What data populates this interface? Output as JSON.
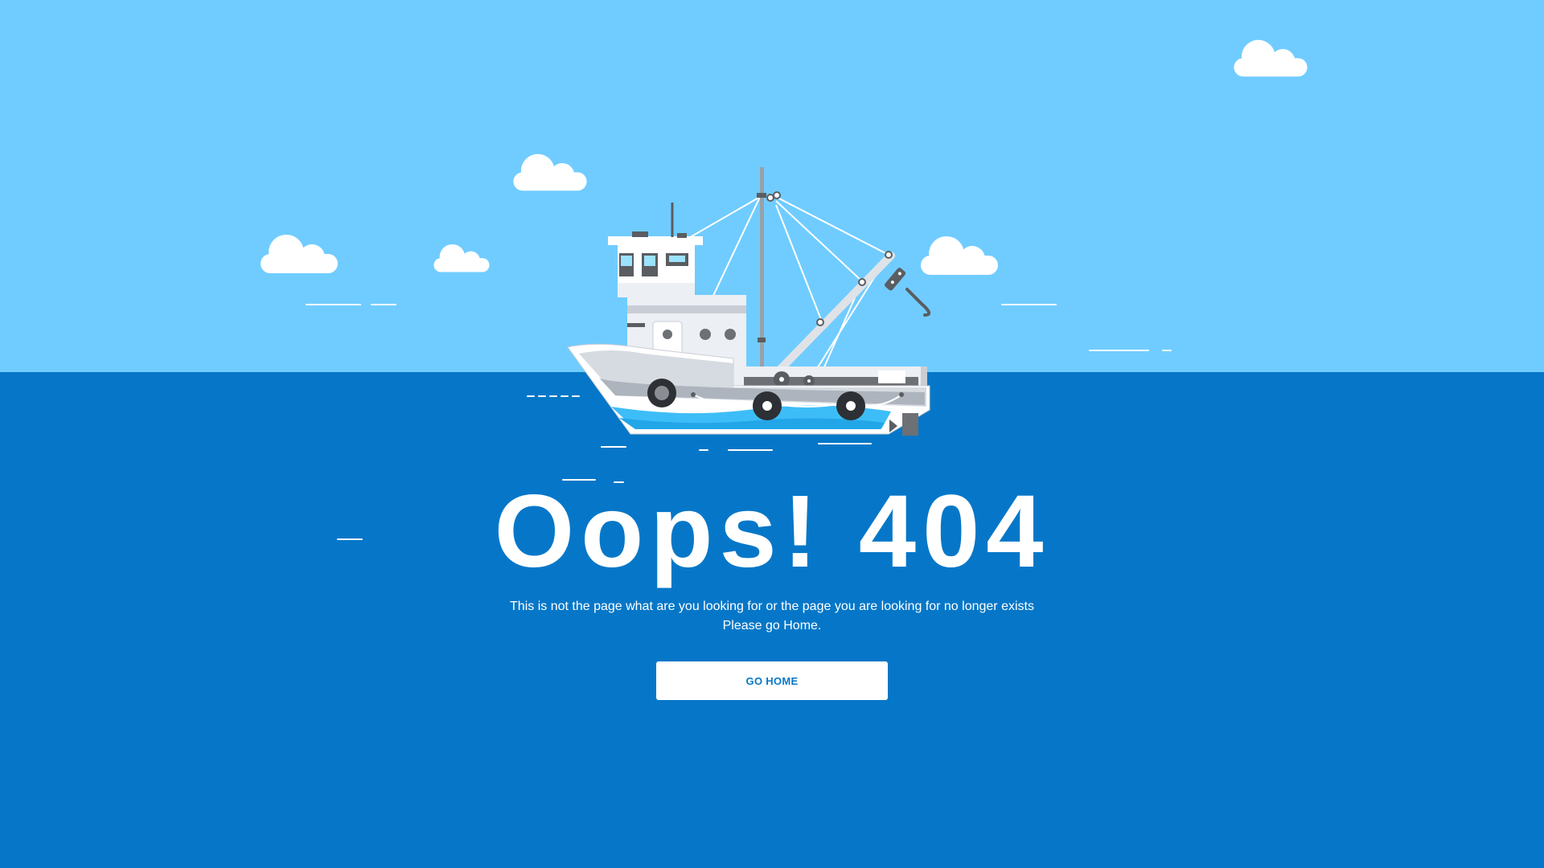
{
  "colors": {
    "sky": "#70ccff",
    "sea": "#0677c8",
    "hull_blue": "#3dbdf7",
    "text": "#ffffff",
    "button_bg": "#ffffff",
    "button_text": "#0677c8"
  },
  "error": {
    "headline": "Oops! 404",
    "message_line1": "This is not the page what are you looking for or the page you are looking for no longer exists",
    "message_line2": "Please go Home."
  },
  "actions": {
    "go_home_label": "GO HOME"
  },
  "illustration": {
    "subject": "fishing-boat-icon",
    "clouds": "cloud-icon"
  }
}
